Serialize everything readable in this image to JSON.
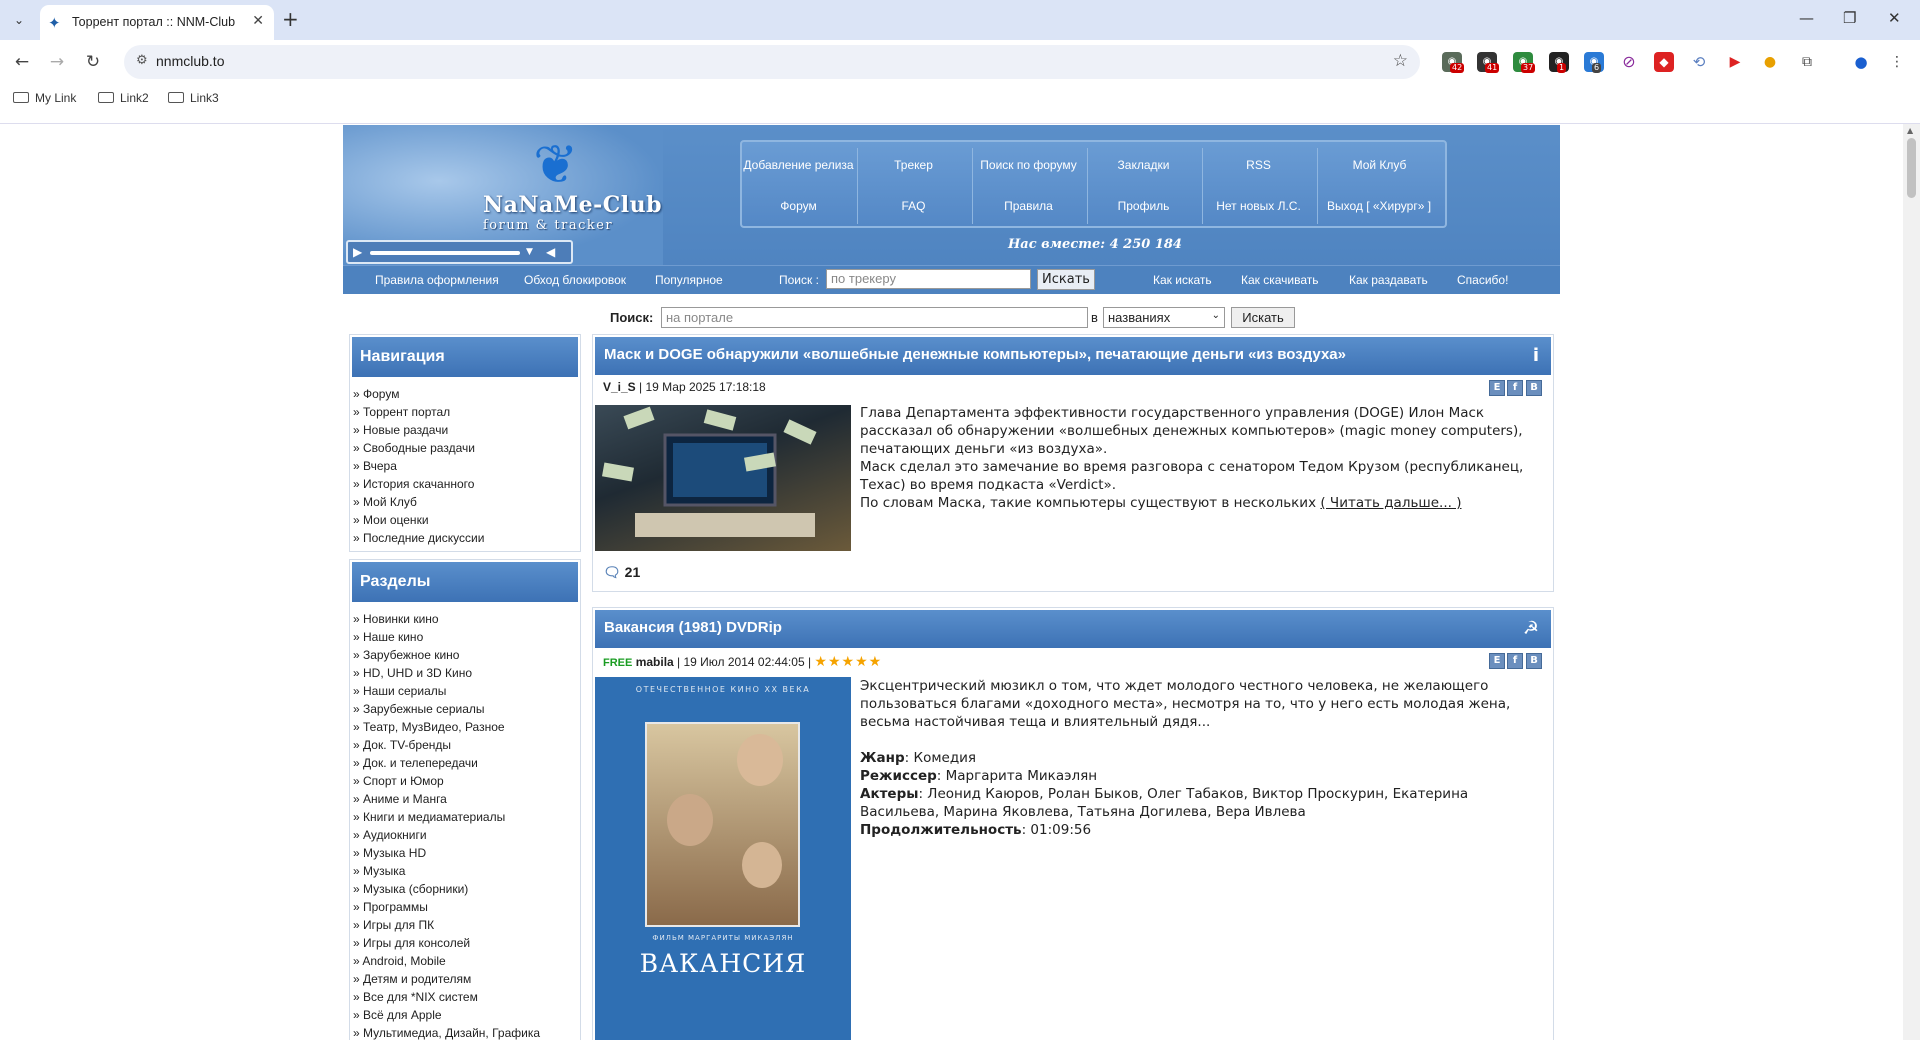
{
  "browser": {
    "tab_title": "Торрент портал :: NNM-Club",
    "url": "nnmclub.to",
    "bookmarks": [
      "My Link",
      "Link2",
      "Link3"
    ],
    "extensions": [
      {
        "name": "ext-1",
        "badge": "42",
        "color": "#5a6b5a"
      },
      {
        "name": "ext-2",
        "badge": "41",
        "color": "#333333"
      },
      {
        "name": "ext-3",
        "badge": "37",
        "color": "#2e8b3e"
      },
      {
        "name": "ext-4",
        "badge": "1",
        "color": "#222222"
      },
      {
        "name": "ext-5",
        "badge": "6",
        "color": "#2a7ad6"
      }
    ]
  },
  "header": {
    "logo_title": "NaNaMe-Club",
    "logo_subtitle": "forum & tracker",
    "menu_top": [
      "Добавление релиза",
      "Трекер",
      "Поиск по форуму",
      "Закладки",
      "RSS",
      "Мой Клуб"
    ],
    "menu_bottom": [
      "Форум",
      "FAQ",
      "Правила",
      "Профиль",
      "Нет новых Л.С.",
      "Выход [ «Хирург» ]"
    ],
    "together": "Нас вместе: 4 250 184",
    "subnav_left": [
      "Правила оформления",
      "Обход блокировок",
      "Популярное"
    ],
    "search_label": "Поиск :",
    "search_placeholder": "по трекеру",
    "search_button": "Искать",
    "subnav_right": [
      "Как искать",
      "Как скачивать",
      "Как раздавать",
      "Спасибо!"
    ]
  },
  "portal_search": {
    "label": "Поиск:",
    "placeholder": "на портале",
    "in_label": "в",
    "select_value": "названиях",
    "button": "Искать"
  },
  "sidebar": {
    "navigation_title": "Навигация",
    "navigation": [
      "» Форум",
      "» Торрент портал",
      "» Новые раздачи",
      "» Свободные раздачи",
      "» Вчера",
      "» История скачанного",
      "» Мой Клуб",
      "» Мои оценки",
      "» Последние дискуссии"
    ],
    "sections_title": "Разделы",
    "sections": [
      "» Новинки кино",
      "» Наше кино",
      "» Зарубежное кино",
      "» HD, UHD и 3D Кино",
      "» Наши сериалы",
      "» Зарубежные сериалы",
      "» Театр, МузВидео, Разное",
      "» Док. TV-бренды",
      "» Док. и телепередачи",
      "» Спорт и Юмор",
      "» Аниме и Манга",
      "» Книги и медиаматериалы",
      "» Аудиокниги",
      "» Музыка HD",
      "» Музыка",
      "» Музыка (сборники)",
      "» Программы",
      "» Игры для ПК",
      "» Игры для консолей",
      "» Android, Mobile",
      "» Детям и родителям",
      "» Все для *NIX систем",
      "» Всё для Apple",
      "» Мультимедиа, Дизайн, Графика"
    ]
  },
  "articles": [
    {
      "title": "Маск и DOGE обнаружили «волшебные денежные компьютеры», печатающие деньги «из воздуха»",
      "author": "V_i_S",
      "date": "| 19 Мар 2025 17:18:18",
      "p1": "Глава Департамента эффективности государственного управления (DOGE) Илон Маск рассказал об обнаружении «волшебных денежных компьютеров» (magic money computers), печатающих деньги «из воздуха».",
      "p2": "Маск сделал это замечание во время разговора с сенатором Тедом Крузом (республиканец, Техас) во время подкаста «Verdict».",
      "p3": "По словам Маска, такие компьютеры существуют в нескольких",
      "readmore": "( Читать дальше... )",
      "comments": "21"
    },
    {
      "title": "Вакансия (1981) DVDRip",
      "free": "FREE",
      "author": "mabila",
      "date": "| 19 Июл 2014 02:44:05 |",
      "stars": "★★★★★",
      "rating": 5,
      "description": "Эксцентрический мюзикл о том, что ждет молодого честного человека, не желающего пользоваться благами «доходного места», несмотря на то, что у него есть молодая жена, весьма настойчивая теща и влиятельный дядя...",
      "genre_label": "Жанр",
      "genre": ": Комедия",
      "director_label": "Режиссер",
      "director": ": Маргарита Микаэлян",
      "actors_label": "Актеры",
      "actors": ": Леонид Каюров, Ролан Быков, Олег Табаков, Виктор Проскурин, Екатерина Васильева, Марина Яковлева, Татьяна Догилева, Вера Ивлева",
      "duration_label": "Продолжительность",
      "duration": ": 01:09:56",
      "poster_top": "ОТЕЧЕСТВЕННОЕ КИНО XX ВЕКА",
      "poster_film": "ФИЛЬМ МАРГАРИТЫ МИКАЭЛЯН",
      "poster_title": "ВАКАНСИЯ"
    }
  ]
}
